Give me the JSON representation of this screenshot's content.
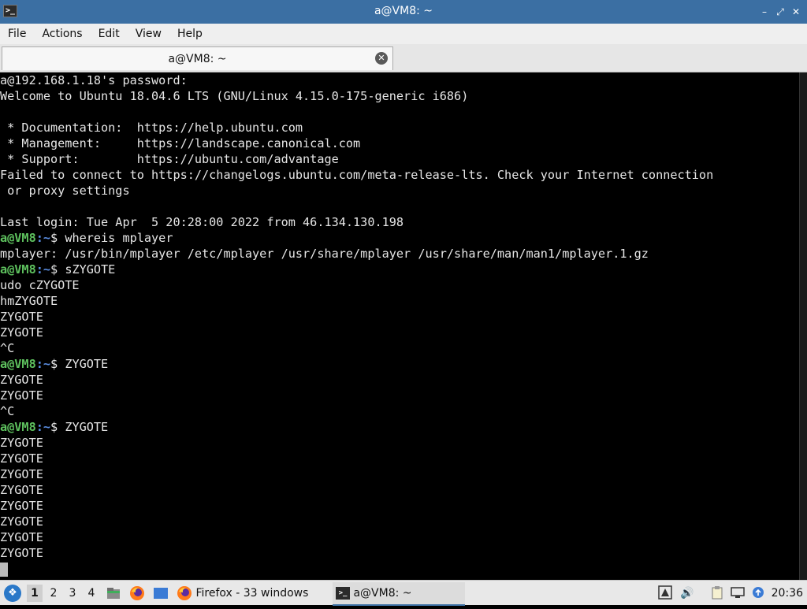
{
  "window": {
    "title": "a@VM8: ~",
    "app_icon_glyph": ">_",
    "controls": {
      "minimize": "–",
      "maximize": "⤢",
      "close": "✕"
    }
  },
  "menubar": {
    "items": [
      "File",
      "Actions",
      "Edit",
      "View",
      "Help"
    ]
  },
  "tab": {
    "label": "a@VM8: ~",
    "close_glyph": "✕"
  },
  "terminal": {
    "prompt_user": "a@VM8",
    "prompt_path": ":~",
    "prompt_symbol": "$ ",
    "lines": [
      {
        "type": "out",
        "text": "a@192.168.1.18's password:"
      },
      {
        "type": "out",
        "text": "Welcome to Ubuntu 18.04.6 LTS (GNU/Linux 4.15.0-175-generic i686)"
      },
      {
        "type": "out",
        "text": ""
      },
      {
        "type": "out",
        "text": " * Documentation:  https://help.ubuntu.com"
      },
      {
        "type": "out",
        "text": " * Management:     https://landscape.canonical.com"
      },
      {
        "type": "out",
        "text": " * Support:        https://ubuntu.com/advantage"
      },
      {
        "type": "out",
        "text": "Failed to connect to https://changelogs.ubuntu.com/meta-release-lts. Check your Internet connection"
      },
      {
        "type": "out",
        "text": " or proxy settings"
      },
      {
        "type": "out",
        "text": ""
      },
      {
        "type": "out",
        "text": "Last login: Tue Apr  5 20:28:00 2022 from 46.134.130.198"
      },
      {
        "type": "cmd",
        "text": "whereis mplayer"
      },
      {
        "type": "out",
        "text": "mplayer: /usr/bin/mplayer /etc/mplayer /usr/share/mplayer /usr/share/man/man1/mplayer.1.gz"
      },
      {
        "type": "cmd",
        "text": "sZYGOTE"
      },
      {
        "type": "out",
        "text": "udo cZYGOTE"
      },
      {
        "type": "out",
        "text": "hmZYGOTE"
      },
      {
        "type": "out",
        "text": "ZYGOTE"
      },
      {
        "type": "out",
        "text": "ZYGOTE"
      },
      {
        "type": "out",
        "text": "^C"
      },
      {
        "type": "cmd",
        "text": "ZYGOTE"
      },
      {
        "type": "out",
        "text": "ZYGOTE"
      },
      {
        "type": "out",
        "text": "ZYGOTE"
      },
      {
        "type": "out",
        "text": "^C"
      },
      {
        "type": "cmd",
        "text": "ZYGOTE"
      },
      {
        "type": "out",
        "text": "ZYGOTE"
      },
      {
        "type": "out",
        "text": "ZYGOTE"
      },
      {
        "type": "out",
        "text": "ZYGOTE"
      },
      {
        "type": "out",
        "text": "ZYGOTE"
      },
      {
        "type": "out",
        "text": "ZYGOTE"
      },
      {
        "type": "out",
        "text": "ZYGOTE"
      },
      {
        "type": "out",
        "text": "ZYGOTE"
      },
      {
        "type": "out",
        "text": "ZYGOTE"
      }
    ]
  },
  "taskbar": {
    "workspaces": [
      "1",
      "2",
      "3",
      "4"
    ],
    "active_workspace": "1",
    "tasks": [
      {
        "label": "Firefox - 33 windows",
        "icon": "firefox-icon"
      },
      {
        "label": "a@VM8: ~",
        "icon": "terminal-icon"
      }
    ],
    "clock": "20:36"
  },
  "colors": {
    "titlebar": "#3b6fa3",
    "terminal_bg": "#000000",
    "terminal_fg": "#e6e6e6",
    "prompt_user": "#5ec15e",
    "prompt_path": "#5a8de0"
  }
}
